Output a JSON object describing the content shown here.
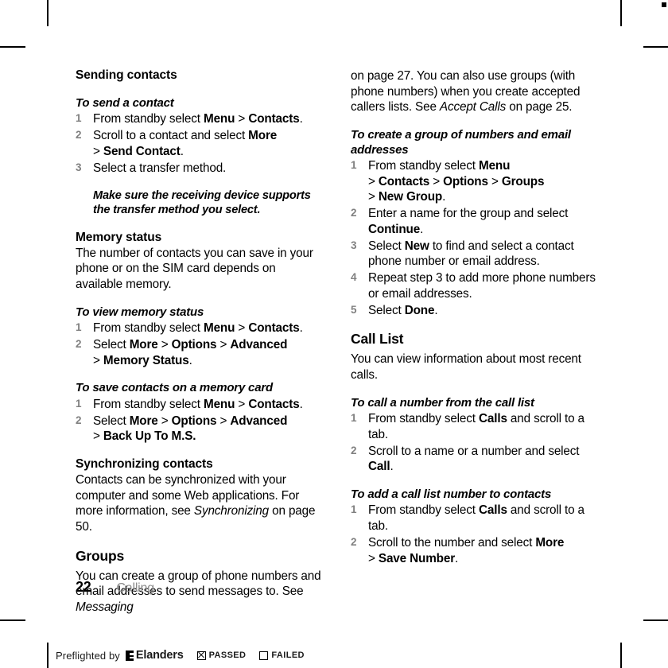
{
  "page": {
    "number": "22",
    "chapter": "Calling"
  },
  "left_column": {
    "sending_contacts": {
      "heading": "Sending contacts",
      "procedure_title": "To send a contact",
      "steps": [
        {
          "parts": [
            {
              "t": "From standby select ",
              "s": "n"
            },
            {
              "t": "Menu",
              "s": "b"
            },
            {
              "t": " > ",
              "s": "n"
            },
            {
              "t": "Contacts",
              "s": "b"
            },
            {
              "t": ".",
              "s": "n"
            }
          ]
        },
        {
          "parts": [
            {
              "t": "Scroll to a contact and select ",
              "s": "n"
            },
            {
              "t": "More",
              "s": "b"
            },
            {
              "t": "\n",
              "s": "br"
            },
            {
              "t": "> ",
              "s": "n"
            },
            {
              "t": "Send Contact",
              "s": "b"
            },
            {
              "t": ".",
              "s": "n"
            }
          ]
        },
        {
          "parts": [
            {
              "t": "Select a transfer method.",
              "s": "n"
            }
          ]
        }
      ]
    },
    "note": "Make sure the receiving device supports the transfer method you select.",
    "memory_status": {
      "heading": "Memory status",
      "body": "The number of contacts you can save in your phone or on the SIM card depends on available memory."
    },
    "view_memory_status": {
      "procedure_title": "To view memory status",
      "steps": [
        {
          "parts": [
            {
              "t": "From standby select ",
              "s": "n"
            },
            {
              "t": "Menu",
              "s": "b"
            },
            {
              "t": " > ",
              "s": "n"
            },
            {
              "t": "Contacts",
              "s": "b"
            },
            {
              "t": ".",
              "s": "n"
            }
          ]
        },
        {
          "parts": [
            {
              "t": "Select ",
              "s": "n"
            },
            {
              "t": "More",
              "s": "b"
            },
            {
              "t": " > ",
              "s": "n"
            },
            {
              "t": "Options",
              "s": "b"
            },
            {
              "t": " > ",
              "s": "n"
            },
            {
              "t": "Advanced",
              "s": "b"
            },
            {
              "t": "\n",
              "s": "br"
            },
            {
              "t": "> ",
              "s": "n"
            },
            {
              "t": "Memory Status",
              "s": "b"
            },
            {
              "t": ".",
              "s": "n"
            }
          ]
        }
      ]
    },
    "save_on_memory_card": {
      "procedure_title": "To save contacts on a memory card",
      "steps": [
        {
          "parts": [
            {
              "t": "From standby select ",
              "s": "n"
            },
            {
              "t": "Menu",
              "s": "b"
            },
            {
              "t": " > ",
              "s": "n"
            },
            {
              "t": "Contacts",
              "s": "b"
            },
            {
              "t": ".",
              "s": "n"
            }
          ]
        },
        {
          "parts": [
            {
              "t": "Select ",
              "s": "n"
            },
            {
              "t": "More",
              "s": "b"
            },
            {
              "t": " > ",
              "s": "n"
            },
            {
              "t": "Options",
              "s": "b"
            },
            {
              "t": " > ",
              "s": "n"
            },
            {
              "t": "Advanced",
              "s": "b"
            },
            {
              "t": "\n",
              "s": "br"
            },
            {
              "t": "> ",
              "s": "n"
            },
            {
              "t": "Back Up To M.S.",
              "s": "b"
            }
          ]
        }
      ]
    },
    "synchronizing_contacts": {
      "heading": "Synchronizing contacts",
      "body_parts": [
        {
          "t": "Contacts can be synchronized with your computer and some Web applications. For more information, see ",
          "s": "n"
        },
        {
          "t": "Synchronizing",
          "s": "i"
        },
        {
          "t": " on page 50.",
          "s": "n"
        }
      ]
    },
    "groups": {
      "heading": "Groups",
      "body_parts": [
        {
          "t": "You can create a group of phone numbers and email addresses to send messages to. See ",
          "s": "n"
        },
        {
          "t": "Messaging",
          "s": "i"
        }
      ]
    }
  },
  "right_column": {
    "groups_continued": {
      "body_parts": [
        {
          "t": "on page 27. You can also use groups (with phone numbers) when you create accepted callers lists. See ",
          "s": "n"
        },
        {
          "t": "Accept Calls",
          "s": "i"
        },
        {
          "t": " on page 25.",
          "s": "n"
        }
      ]
    },
    "create_group": {
      "procedure_title": "To create a group of numbers and email addresses",
      "steps": [
        {
          "parts": [
            {
              "t": "From standby select ",
              "s": "n"
            },
            {
              "t": "Menu",
              "s": "b"
            },
            {
              "t": "\n",
              "s": "br"
            },
            {
              "t": "> ",
              "s": "n"
            },
            {
              "t": "Contacts",
              "s": "b"
            },
            {
              "t": " > ",
              "s": "n"
            },
            {
              "t": "Options",
              "s": "b"
            },
            {
              "t": " > ",
              "s": "n"
            },
            {
              "t": "Groups",
              "s": "b"
            },
            {
              "t": "\n",
              "s": "br"
            },
            {
              "t": "> ",
              "s": "n"
            },
            {
              "t": "New Group",
              "s": "b"
            },
            {
              "t": ".",
              "s": "n"
            }
          ]
        },
        {
          "parts": [
            {
              "t": "Enter a name for the group and select ",
              "s": "n"
            },
            {
              "t": "Continue",
              "s": "b"
            },
            {
              "t": ".",
              "s": "n"
            }
          ]
        },
        {
          "parts": [
            {
              "t": "Select ",
              "s": "n"
            },
            {
              "t": "New",
              "s": "b"
            },
            {
              "t": " to find and select a contact phone number or email address.",
              "s": "n"
            }
          ]
        },
        {
          "parts": [
            {
              "t": "Repeat step 3 to add more phone numbers or email addresses.",
              "s": "n"
            }
          ]
        },
        {
          "parts": [
            {
              "t": "Select ",
              "s": "n"
            },
            {
              "t": "Done",
              "s": "b"
            },
            {
              "t": ".",
              "s": "n"
            }
          ]
        }
      ]
    },
    "call_list": {
      "heading": "Call List",
      "body": "You can view information about most recent calls."
    },
    "call_from_list": {
      "procedure_title": "To call a number from the call list",
      "steps": [
        {
          "parts": [
            {
              "t": "From standby select ",
              "s": "n"
            },
            {
              "t": "Calls",
              "s": "b"
            },
            {
              "t": " and scroll to a tab.",
              "s": "n"
            }
          ]
        },
        {
          "parts": [
            {
              "t": "Scroll to a name or a number and select ",
              "s": "n"
            },
            {
              "t": "Call",
              "s": "b"
            },
            {
              "t": ".",
              "s": "n"
            }
          ]
        }
      ]
    },
    "add_to_contacts": {
      "procedure_title": "To add a call list number to contacts",
      "steps": [
        {
          "parts": [
            {
              "t": "From standby select ",
              "s": "n"
            },
            {
              "t": "Calls",
              "s": "b"
            },
            {
              "t": " and scroll to a tab.",
              "s": "n"
            }
          ]
        },
        {
          "parts": [
            {
              "t": "Scroll to the number and select ",
              "s": "n"
            },
            {
              "t": "More",
              "s": "b"
            },
            {
              "t": "\n",
              "s": "br"
            },
            {
              "t": "> ",
              "s": "n"
            },
            {
              "t": "Save Number",
              "s": "b"
            },
            {
              "t": ".",
              "s": "n"
            }
          ]
        }
      ]
    }
  },
  "preflight": {
    "label": "Preflighted by",
    "logo_text": "Elanders",
    "passed_label": "PASSED",
    "failed_label": "FAILED",
    "passed_checked": true,
    "failed_checked": false
  }
}
